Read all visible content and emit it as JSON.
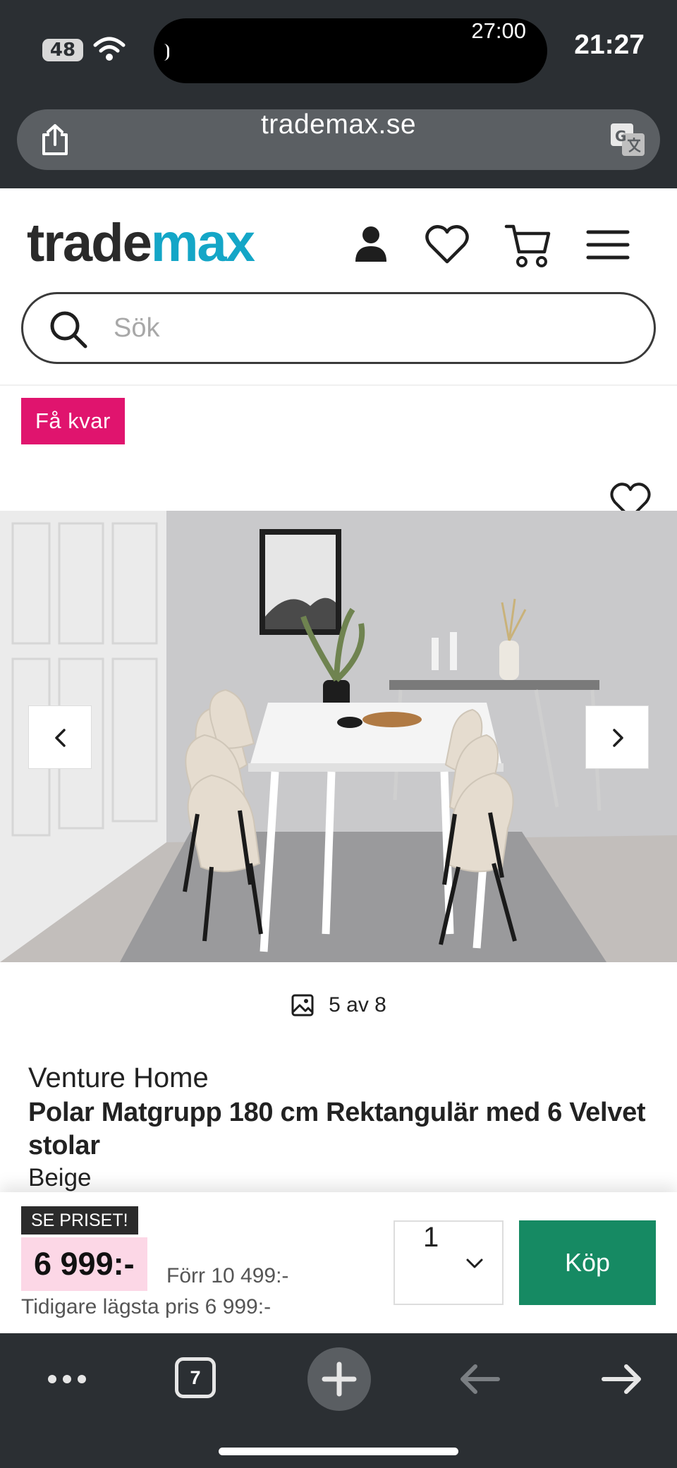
{
  "status_bar": {
    "signal_badge": "48",
    "island_timer": "27:00",
    "clock": "21:27"
  },
  "browser": {
    "url": "trademax.se",
    "tabs_count": "7"
  },
  "header": {
    "logo_part1": "trade",
    "logo_part2": "max",
    "search_placeholder": "Sök"
  },
  "product": {
    "badge": "Få kvar",
    "image_counter": "5 av 8",
    "brand": "Venture Home",
    "title": "Polar Matgrupp 180 cm Rektangulär med 6 Velvet stolar",
    "color": "Beige"
  },
  "buy_bar": {
    "see_price_label": "SE PRISET!",
    "price": "6 999:-",
    "previous_price": "Förr 10 499:-",
    "lowest_price": "Tidigare lägsta pris 6 999:-",
    "quantity": "1",
    "buy_label": "Köp"
  },
  "colors": {
    "brand_cyan": "#14a6c7",
    "badge_pink": "#e0146e",
    "buy_green": "#168a63",
    "price_bg": "#fcd7e6",
    "chrome_dark": "#2b2f33"
  },
  "icons": [
    "wifi-icon",
    "share-icon",
    "translate-icon",
    "user-icon",
    "heart-icon",
    "cart-icon",
    "menu-icon",
    "search-icon",
    "wishlist-heart-icon",
    "chevron-left-icon",
    "chevron-right-icon",
    "image-icon",
    "chevron-down-icon",
    "more-icon",
    "tabs-icon",
    "plus-icon",
    "back-arrow-icon",
    "forward-arrow-icon"
  ]
}
